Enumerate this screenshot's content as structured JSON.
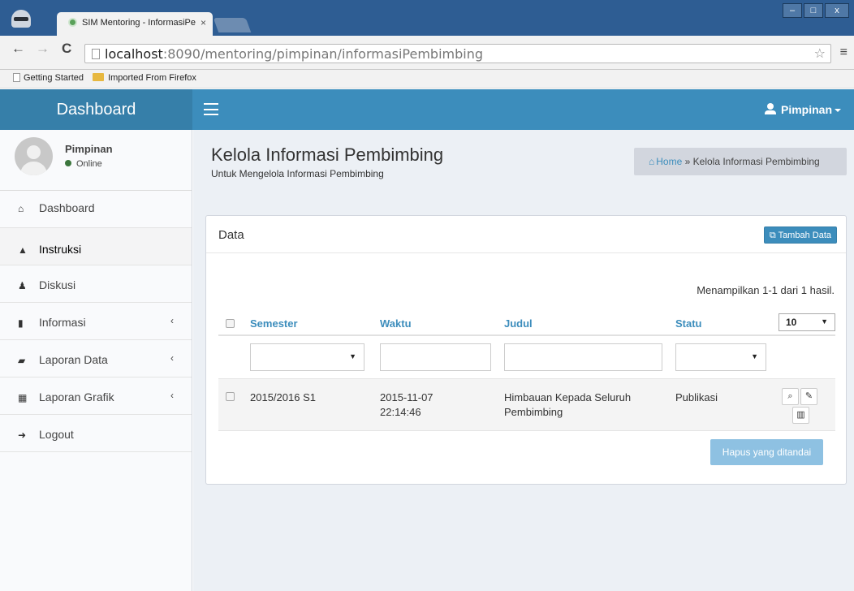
{
  "browser": {
    "tab_title": "SIM Mentoring - InformasiPe",
    "tab_close": "×",
    "url_host": "localhost",
    "url_rest": ":8090/mentoring/pimpinan/informasiPembimbing",
    "bookmarks": [
      "Getting Started",
      "Imported From Firefox"
    ],
    "window_buttons": [
      "–",
      "□",
      "x"
    ]
  },
  "header": {
    "brand": "Dashboard",
    "user_label": "Pimpinan"
  },
  "sidebar": {
    "user_name": "Pimpinan",
    "user_status": "Online",
    "items": [
      {
        "label": "Dashboard",
        "icon": "home-icon",
        "glyph": "⌂"
      },
      {
        "label": "Instruksi",
        "icon": "warning-icon",
        "glyph": "▲"
      },
      {
        "label": "Diskusi",
        "icon": "group-icon",
        "glyph": "♟"
      },
      {
        "label": "Informasi",
        "icon": "file-icon",
        "glyph": "▮",
        "chevron": "‹"
      },
      {
        "label": "Laporan Data",
        "icon": "book-icon",
        "glyph": "▰",
        "chevron": "‹"
      },
      {
        "label": "Laporan Grafik",
        "icon": "bar-chart-icon",
        "glyph": "▦",
        "chevron": "‹"
      },
      {
        "label": "Logout",
        "icon": "sign-out-icon",
        "glyph": "➜"
      }
    ]
  },
  "page": {
    "title": "Kelola Informasi Pembimbing",
    "subtitle": "Untuk Mengelola Informasi Pembimbing",
    "breadcrumb_home": "Home",
    "breadcrumb_sep": "»",
    "breadcrumb_current": "Kelola Informasi Pembimbing"
  },
  "box": {
    "title": "Data",
    "add_button": "Tambah Data",
    "summary": "Menampilkan 1-1 dari 1 hasil.",
    "page_size": "10",
    "columns": [
      "Semester",
      "Waktu",
      "Judul",
      "Statu"
    ],
    "rows": [
      {
        "semester": "2015/2016 S1",
        "waktu_date": "2015-11-07",
        "waktu_time": "22:14:46",
        "judul_line1": "Himbauan Kepada Seluruh",
        "judul_line2": "Pembimbing",
        "status": "Publikasi"
      }
    ],
    "delete_button": "Hapus yang ditandai"
  },
  "colors": {
    "primary": "#3c8dbc",
    "primary_dark": "#367fa9",
    "content_bg": "#ecf0f5",
    "sidebar_bg": "#f9fafc"
  }
}
